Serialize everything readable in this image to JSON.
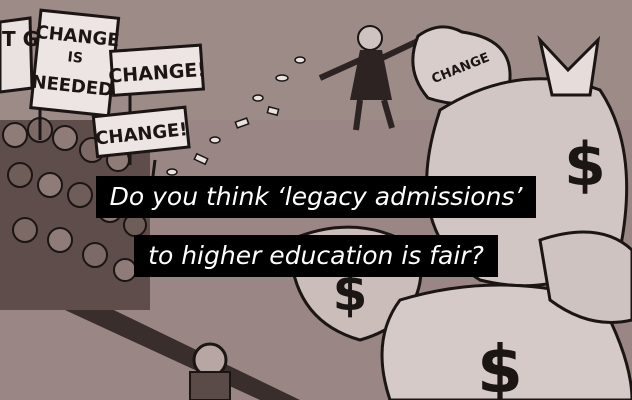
{
  "caption": {
    "line1": "Do you think ‘legacy admissions’",
    "line2": "to higher education is fair?"
  },
  "cartoon": {
    "sign_partial": "T GE",
    "sign_change_is_needed": [
      "CHANGE",
      "IS",
      "NEEDED"
    ],
    "sign_change_top": "CHANGE!",
    "sign_change_bottom": "CHANGE!",
    "bag_label": "CHANGE",
    "dollar_symbol": "$"
  },
  "colors": {
    "background": "#9a8785",
    "ink": "#1b1514",
    "caption_bg": "#000000",
    "caption_text": "#ffffff"
  }
}
